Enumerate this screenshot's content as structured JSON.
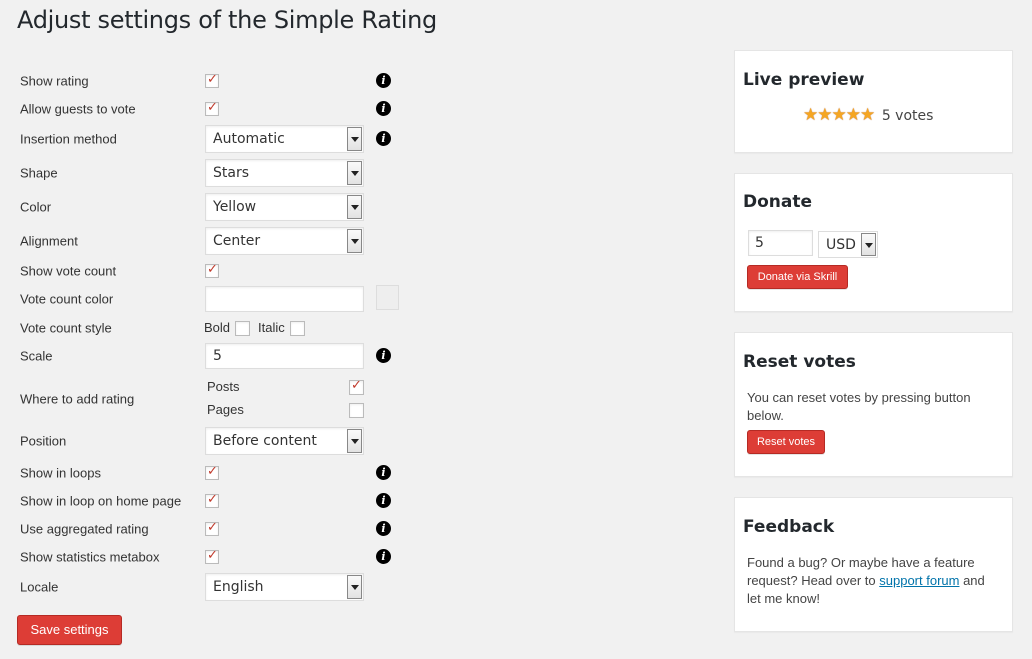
{
  "page": {
    "title": "Adjust settings of the Simple Rating"
  },
  "settings": {
    "show_rating": {
      "label": "Show rating",
      "checked": true
    },
    "allow_guests": {
      "label": "Allow guests to vote",
      "checked": true
    },
    "insertion_method": {
      "label": "Insertion method",
      "value": "Automatic"
    },
    "shape": {
      "label": "Shape",
      "value": "Stars"
    },
    "color": {
      "label": "Color",
      "value": "Yellow"
    },
    "alignment": {
      "label": "Alignment",
      "value": "Center"
    },
    "show_vote_count": {
      "label": "Show vote count",
      "checked": true
    },
    "vote_count_color": {
      "label": "Vote count color",
      "value": ""
    },
    "vote_count_style": {
      "label": "Vote count style",
      "bold_label": "Bold",
      "italic_label": "Italic",
      "bold": false,
      "italic": false
    },
    "scale": {
      "label": "Scale",
      "value": "5"
    },
    "where_to_add": {
      "label": "Where to add rating",
      "posts_label": "Posts",
      "pages_label": "Pages",
      "posts": true,
      "pages": false
    },
    "position": {
      "label": "Position",
      "value": "Before content"
    },
    "show_in_loops": {
      "label": "Show in loops",
      "checked": true
    },
    "show_in_loop_home": {
      "label": "Show in loop on home page",
      "checked": true
    },
    "use_aggregated": {
      "label": "Use aggregated rating",
      "checked": true
    },
    "show_statistics": {
      "label": "Show statistics metabox",
      "checked": true
    },
    "locale": {
      "label": "Locale",
      "value": "English"
    },
    "save_label": "Save settings",
    "info_glyph": "i",
    "check_glyph": "✓"
  },
  "sidebar": {
    "live_preview": {
      "title": "Live preview",
      "stars": "★★★★★",
      "votes": "5 votes",
      "rating": 5,
      "max": 5
    },
    "donate": {
      "title": "Donate",
      "amount": "5",
      "currency": "USD",
      "button": "Donate via Skrill"
    },
    "reset": {
      "title": "Reset votes",
      "text": "You can reset votes by pressing button below.",
      "button": "Reset votes"
    },
    "feedback": {
      "title": "Feedback",
      "text_before": "Found a bug? Or maybe have a feature request? Head over to ",
      "link": "support forum",
      "text_after": " and let me know!"
    }
  },
  "colors": {
    "button_red": "#dd3d36",
    "check_red": "#c0392b",
    "link": "#0073aa",
    "star": "#f5a623"
  }
}
